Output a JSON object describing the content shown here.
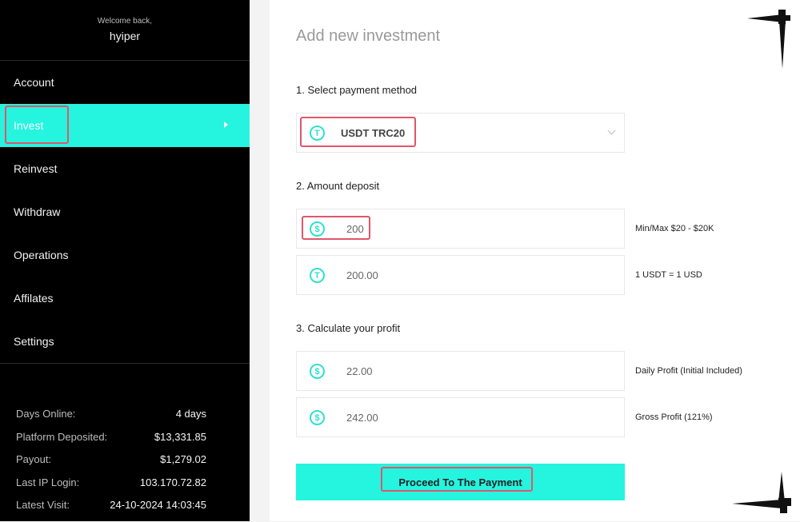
{
  "sidebar": {
    "welcome": "Welcome back,",
    "username": "hyiper",
    "items": [
      {
        "label": "Account"
      },
      {
        "label": "Invest"
      },
      {
        "label": "Reinvest"
      },
      {
        "label": "Withdraw"
      },
      {
        "label": "Operations"
      },
      {
        "label": "Affilates"
      },
      {
        "label": "Settings"
      }
    ],
    "active_item": "Invest",
    "stats": [
      {
        "label": "Days Online:",
        "value": "4 days"
      },
      {
        "label": "Platform Deposited:",
        "value": "$13,331.85"
      },
      {
        "label": "Payout:",
        "value": "$1,279.02"
      },
      {
        "label": "Last IP Login:",
        "value": "103.170.72.82"
      },
      {
        "label": "Latest Visit:",
        "value": "24-10-2024 14:03:45"
      }
    ]
  },
  "main": {
    "title": "Add new investment",
    "step1": "1. Select payment method",
    "payment_method": "USDT TRC20",
    "step2": "2. Amount deposit",
    "amount": "200",
    "amount_note": "Min/Max $20 - $20K",
    "converted": "200.00",
    "rate_note": "1 USDT = 1 USD",
    "step3": "3. Calculate your profit",
    "daily_profit": "22.00",
    "daily_note": "Daily Profit (Initial Included)",
    "gross_profit": "242.00",
    "gross_note": "Gross Profit (121%)",
    "proceed_label": "Proceed To The Payment"
  },
  "icons": {
    "usdt": "T",
    "dollar": "$"
  },
  "colors": {
    "accent": "#25f4df",
    "highlight": "#e0566a",
    "sidebar_bg": "#000000"
  }
}
